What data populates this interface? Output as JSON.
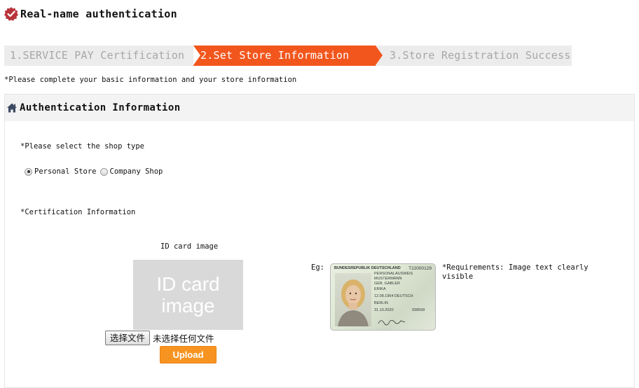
{
  "page": {
    "title": "Real-name authentication",
    "notice": "*Please complete your basic information and your store information"
  },
  "steps": [
    {
      "label": "1.SERVICE PAY Certification",
      "state": "done"
    },
    {
      "label": "2.Set Store Information",
      "state": "active"
    },
    {
      "label": "3.Store Registration Success",
      "state": "pending"
    }
  ],
  "panel": {
    "title": "Authentication Information",
    "shop_type_label": "*Please select the shop type",
    "shop_types": [
      {
        "label": "Personal Store",
        "checked": true
      },
      {
        "label": "Company Shop",
        "checked": false
      }
    ],
    "cert_label": "*Certification Information",
    "id_caption": "ID card image",
    "id_placeholder_line1": "ID card",
    "id_placeholder_line2": "image",
    "file_button": "选择文件",
    "file_status": "未选择任何文件",
    "upload_button": "Upload",
    "eg_label": "Eg:",
    "requirements": "*Requirements: Image text clearly visible",
    "sample_card": {
      "header": "BUNDESREPUBLIK DEUTSCHLAND",
      "number": "T22000129",
      "lines": [
        "PERSONALAUSWEIS",
        "MUSTERMANN",
        "GEB. GABLER",
        "ERIKA",
        "12.08.1964 DEUTSCH",
        "BERLIN",
        "31.10.2020",
        "938568"
      ]
    }
  },
  "colors": {
    "accent_step": "#f2561d",
    "upload_button": "#f79421",
    "step_bar": "#ececec",
    "panel_header": "#f3f3f3",
    "title_icon": "#c0392b"
  }
}
